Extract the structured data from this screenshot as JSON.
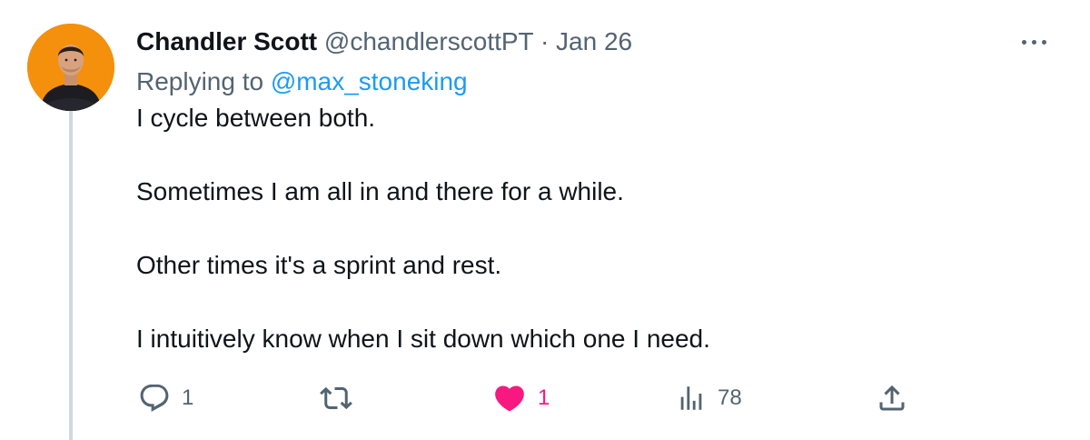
{
  "author": {
    "display_name": "Chandler Scott",
    "handle": "@chandlerscottPT",
    "separator": "·",
    "timestamp": "Jan 26",
    "avatar_icon": "profile-photo",
    "avatar_bg": "#f4900c"
  },
  "reply": {
    "prefix": "Replying to",
    "handle": "@max_stoneking"
  },
  "body": {
    "paragraphs": [
      "I cycle between both.",
      "Sometimes I am all in and there for a while.",
      "Other times it's a sprint and rest.",
      "I intuitively know when I sit down which one I need."
    ]
  },
  "actions": {
    "reply": {
      "icon": "reply-icon",
      "count": "1"
    },
    "retweet": {
      "icon": "retweet-icon",
      "count": ""
    },
    "like": {
      "icon": "heart-icon",
      "count": "1",
      "active": true,
      "color": "#f91880"
    },
    "views": {
      "icon": "analytics-icon",
      "count": "78"
    },
    "share": {
      "icon": "share-icon"
    }
  },
  "more": {
    "icon": "more-icon"
  },
  "colors": {
    "text": "#0f1419",
    "secondary": "#536471",
    "link": "#1d9bf0",
    "like": "#f91880",
    "thread_line": "#cfd9de"
  }
}
